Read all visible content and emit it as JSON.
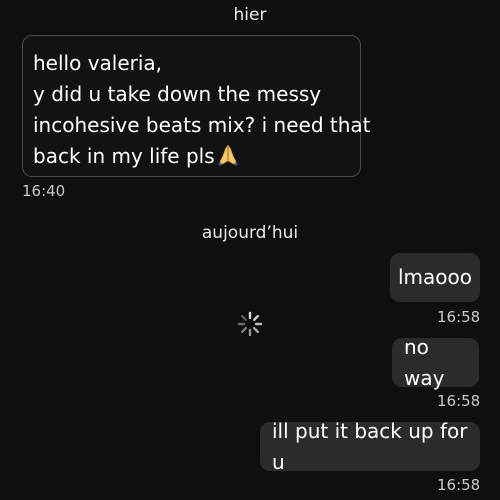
{
  "conversation": {
    "sections": [
      {
        "day_label": "hier",
        "messages": [
          {
            "direction": "incoming",
            "lines": [
              "hello valeria,",
              "y did u take down the messy",
              "incohesive beats mix? i need that",
              "back in my life pls"
            ],
            "emoji": "folded-hands",
            "time": "16:40"
          }
        ]
      },
      {
        "day_label": "aujourd’hui",
        "messages": [
          {
            "direction": "outgoing",
            "text": "lmaooo",
            "time": "16:58"
          },
          {
            "direction": "outgoing",
            "text": "no way",
            "time": "16:58"
          },
          {
            "direction": "outgoing",
            "text": "ill put it back up for u",
            "time": "16:58"
          }
        ]
      }
    ],
    "loading_indicator": "spinner-icon"
  },
  "colors": {
    "background": "#0f0f0f",
    "incoming_bubble": "#121212",
    "incoming_border": "#4a4a4a",
    "outgoing_bubble": "#2b2b2b",
    "text": "#ffffff",
    "timestamp": "#c9c9c9"
  }
}
